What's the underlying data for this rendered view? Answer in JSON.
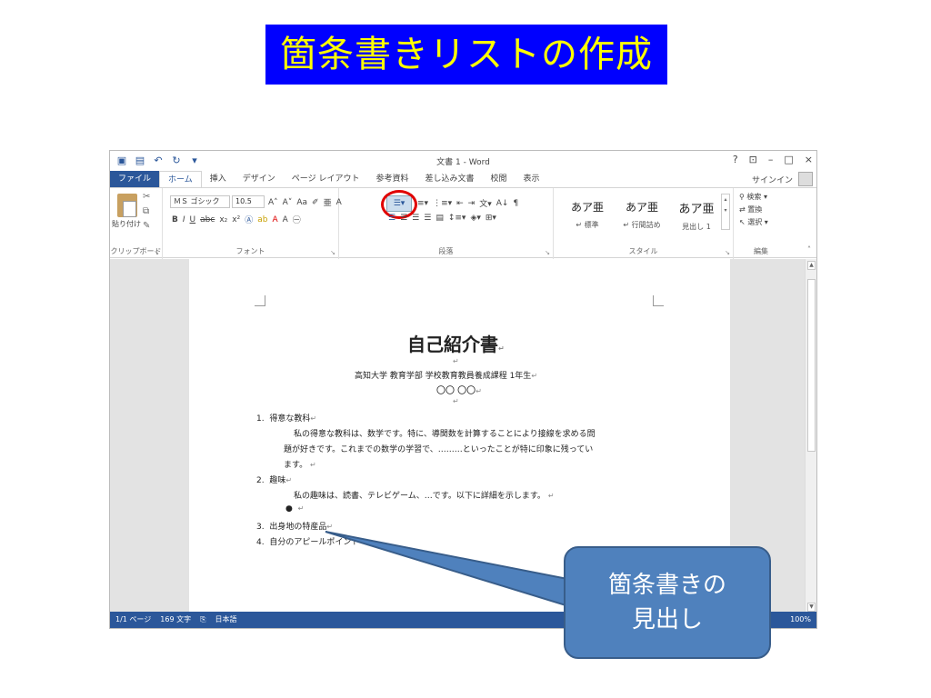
{
  "slide": {
    "title": "箇条書きリストの作成"
  },
  "window": {
    "doc_title": "文書 1 - Word",
    "controls": [
      "?",
      "⊡",
      "–",
      "□",
      "×"
    ]
  },
  "tabs": [
    {
      "label": "ファイル"
    },
    {
      "label": "ホーム"
    },
    {
      "label": "挿入"
    },
    {
      "label": "デザイン"
    },
    {
      "label": "ページ レイアウト"
    },
    {
      "label": "参考資料"
    },
    {
      "label": "差し込み文書"
    },
    {
      "label": "校閲"
    },
    {
      "label": "表示"
    }
  ],
  "signin": "サインイン",
  "ribbon": {
    "clipboard": {
      "paste": "貼り付け",
      "label": "クリップボード"
    },
    "font": {
      "name": "ＭＳ ゴシック",
      "size": "10.5",
      "label": "フォント"
    },
    "paragraph": {
      "label": "段落"
    },
    "styles": {
      "label": "スタイル",
      "items": [
        {
          "sample": "あア亜",
          "name": "↵ 標準"
        },
        {
          "sample": "あア亜",
          "name": "↵ 行間詰め"
        },
        {
          "sample": "あア亜",
          "name": "見出し 1"
        }
      ]
    },
    "editing": {
      "find": "検索 ▾",
      "replace": "置換",
      "select": "選択 ▾",
      "label": "編集"
    }
  },
  "document": {
    "heading": "自己紹介書",
    "affiliation": "高知大学 教育学部 学校教育教員養成課程 1年生",
    "name": "〇〇 〇〇",
    "items": [
      {
        "num": "1.",
        "title": "得意な教科"
      },
      {
        "num": "2.",
        "title": "趣味"
      },
      {
        "num": "3.",
        "title": "出身地の特産品"
      },
      {
        "num": "4.",
        "title": "自分のアピールポイント"
      }
    ],
    "para1_lines": [
      "私の得意な教科は、数学です。特に、導関数を計算することにより接線を求める問",
      "題が好きです。これまでの数学の学習で、………といったことが特に印象に残ってい",
      "ます。"
    ],
    "para2": "私の趣味は、読書、テレビゲーム、…です。以下に詳細を示します。",
    "bullet": "●"
  },
  "status": {
    "page": "1/1 ページ",
    "words": "169 文字",
    "lang": "日本語",
    "zoom": "100%"
  },
  "callout": {
    "line1": "箇条書きの",
    "line2": "見出し"
  },
  "colors": {
    "title_bg": "#0000ff",
    "title_fg": "#ffff00",
    "word_blue": "#2b579a",
    "callout": "#4f81bd",
    "highlight_circle": "#e00000"
  }
}
